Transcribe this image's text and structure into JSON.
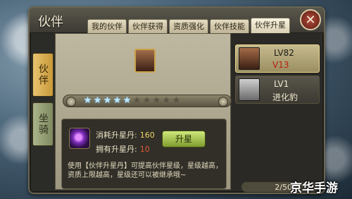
{
  "window": {
    "title": "伙伴",
    "close_icon": "close-icon"
  },
  "tabs": [
    {
      "label": "我的伙伴",
      "active": false
    },
    {
      "label": "伙伴获得",
      "active": false
    },
    {
      "label": "资质强化",
      "active": false
    },
    {
      "label": "伙伴技能",
      "active": false
    },
    {
      "label": "伙伴升星",
      "active": true
    }
  ],
  "side_tabs": [
    {
      "label": "伙伴",
      "active": true
    },
    {
      "label": "坐骑",
      "active": false
    }
  ],
  "stars": {
    "total": 10,
    "filled": 5
  },
  "upgrade": {
    "cost_label": "消耗升星丹:",
    "cost_value": "160",
    "own_label": "拥有升星丹:",
    "own_value": "10",
    "button_label": "升星",
    "description": "使用【伙伴升星丹】可提高伙伴星级，星级越高，资质上限越高，星级还可以被继承哦~"
  },
  "partners": [
    {
      "level": "LV82",
      "sub": "V13",
      "selected": true
    },
    {
      "level": "LV1",
      "sub": "进化豹",
      "selected": false
    }
  ],
  "pagination": {
    "text": "2/50"
  },
  "watermark": "京华手游",
  "colors": {
    "accent_gold": "#c9a24a",
    "star_on": "#bfe8ff",
    "button_green": "#a8c24f",
    "value_red": "#e05a3a",
    "value_yellow": "#f2d263"
  }
}
